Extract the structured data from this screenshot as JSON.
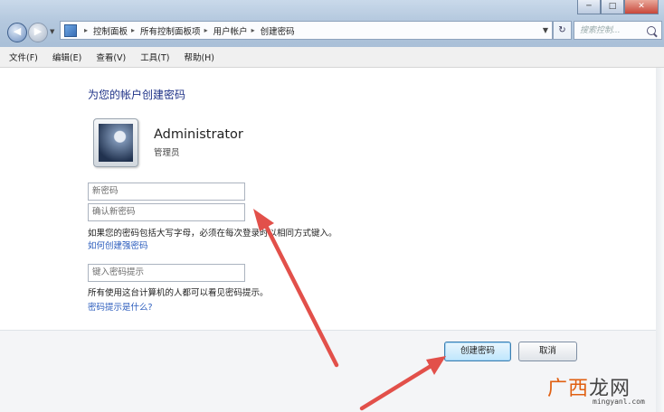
{
  "window": {
    "minimize_glyph": "─",
    "maximize_glyph": "□",
    "close_glyph": "✕"
  },
  "nav": {
    "back_glyph": "◀",
    "forward_glyph": "▶",
    "recent_glyph": "▼"
  },
  "address": {
    "crumbs": [
      "控制面板",
      "所有控制面板项",
      "用户帐户",
      "创建密码"
    ],
    "separator": "▸",
    "dropdown_glyph": "▼",
    "refresh_glyph": "↻"
  },
  "search": {
    "placeholder": "搜索控制..."
  },
  "menu": [
    "文件(F)",
    "编辑(E)",
    "查看(V)",
    "工具(T)",
    "帮助(H)"
  ],
  "page": {
    "title": "为您的帐户创建密码",
    "user_name": "Administrator",
    "user_role": "管理员",
    "new_password_placeholder": "新密码",
    "confirm_password_placeholder": "确认新密码",
    "caps_note": "如果您的密码包括大写字母，必须在每次登录时以相同方式键入。",
    "how_to_link": "如何创建强密码",
    "hint_placeholder": "键入密码提示",
    "hint_note": "所有使用这台计算机的人都可以看见密码提示。",
    "hint_link": "密码提示是什么?"
  },
  "buttons": {
    "create": "创建密码",
    "cancel": "取消"
  },
  "watermark": {
    "logo_a": "广西",
    "logo_b": "龙网",
    "url": "mingyanl.com"
  },
  "colors": {
    "title": "#1e3287",
    "link": "#2c5dbd",
    "primary_button": "#bee6fd",
    "arrow": "#e2504a"
  }
}
